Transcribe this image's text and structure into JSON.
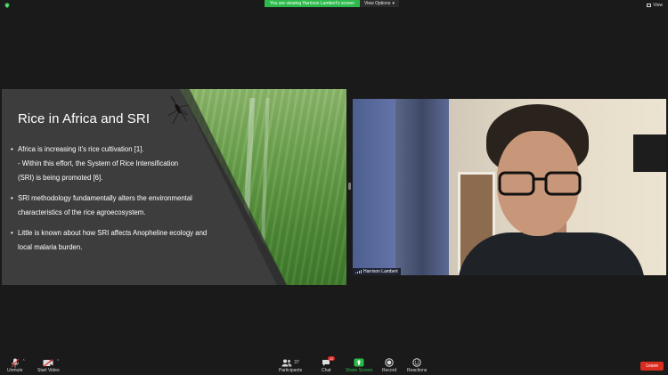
{
  "topbar": {
    "banner_text": "You are viewing Harrison Lambert's screen",
    "view_options_label": "View Options",
    "view_label": "View",
    "security_color": "#2cbb4b"
  },
  "slide": {
    "title": "Rice in Africa and SRI",
    "bullets": [
      {
        "lines": [
          "Africa is increasing it’s rice cultivation [1].",
          "- Within this effort, the System of Rice Intensification",
          "(SRI) is being promoted [6]."
        ]
      },
      {
        "lines": [
          "SRI methodology fundamentally alters the environmental",
          "characteristics of the rice agroecosystem."
        ]
      },
      {
        "lines": [
          "Little is known about how SRI affects Anopheline ecology and",
          "local malaria burden."
        ]
      }
    ]
  },
  "video": {
    "participant_name": "Harrison Lambert"
  },
  "toolbar": {
    "unmute_label": "Unmute",
    "start_video_label": "Start Video",
    "participants_label": "Participants",
    "participants_count": "37",
    "chat_label": "Chat",
    "chat_badge": "12",
    "share_screen_label": "Share Screen",
    "record_label": "Record",
    "reactions_label": "Reactions",
    "leave_label": "Leave",
    "share_color": "#2cbb4b",
    "leave_color": "#d92d20"
  }
}
